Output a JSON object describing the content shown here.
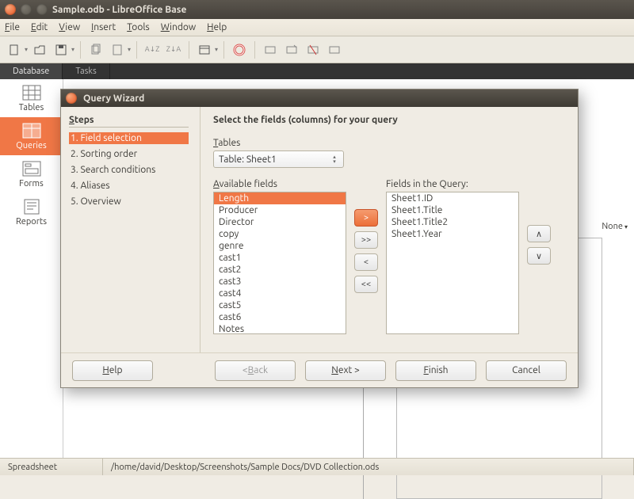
{
  "window": {
    "title": "Sample.odb - LibreOffice Base"
  },
  "menubar": {
    "items": [
      "File",
      "Edit",
      "View",
      "Insert",
      "Tools",
      "Window",
      "Help"
    ]
  },
  "dbnav": {
    "tables": "Tables",
    "queries": "Queries",
    "forms": "Forms",
    "reports": "Reports"
  },
  "tabs": {
    "database": "Database",
    "tasks": "Tasks"
  },
  "right_dropdown": "None",
  "wizard": {
    "title": "Query Wizard",
    "steps_header": "Steps",
    "steps": {
      "s1": "1. Field selection",
      "s2": "2. Sorting order",
      "s3": "3. Search conditions",
      "s4": "4. Aliases",
      "s5": "5. Overview"
    },
    "instruction": "Select the fields (columns) for your query",
    "tables_label": "Tables",
    "table_selected": "Table: Sheet1",
    "available_label": "Available fields",
    "inquery_label": "Fields in the Query:",
    "available": {
      "a0": "Length",
      "a1": "Producer",
      "a2": "Director",
      "a3": "copy",
      "a4": "genre",
      "a5": "cast1",
      "a6": "cast2",
      "a7": "cast3",
      "a8": "cast4",
      "a9": "cast5",
      "a10": "cast6",
      "a11": "Notes"
    },
    "inquery": {
      "q0": "Sheet1.ID",
      "q1": "Sheet1.Title",
      "q2": "Sheet1.Title2",
      "q3": "Sheet1.Year"
    },
    "arrows": {
      "add": ">",
      "addall": ">>",
      "remove": "<",
      "removeall": "<<",
      "up": "∧",
      "down": "∨"
    },
    "buttons": {
      "help": "Help",
      "back": "< Back",
      "next": "Next >",
      "finish": "Finish",
      "cancel": "Cancel"
    }
  },
  "statusbar": {
    "left": "Spreadsheet",
    "path": "/home/david/Desktop/Screenshots/Sample Docs/DVD Collection.ods"
  }
}
